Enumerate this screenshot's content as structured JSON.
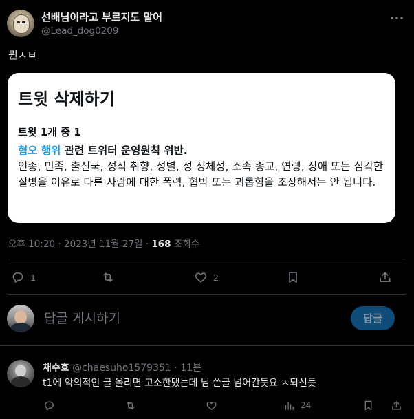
{
  "tweet": {
    "display_name": "선배님이라고 부르지도 말어",
    "handle": "@Lead_dog0209",
    "text": "뭔ㅅㅂ",
    "deleted_card": {
      "title": "트윗 삭제하기",
      "count": "트윗 1개 중 1",
      "reason_link": "혐오 행위",
      "reason_rest": " 관련 트위터 운영원칙 위반.",
      "description": "인종, 민족, 출신국, 성적 취향, 성별, 성 정체성, 소속 종교, 연령, 장애 또는 심각한 질병을 이유로 다른 사람에 대한 폭력, 협박 또는 괴롭힘을 조장해서는 안 됩니다."
    },
    "meta": {
      "timestamp": "오후 10:20 · 2023년 11월 27일 · ",
      "views_count": "168",
      "views_label": " 조회수"
    },
    "actions": {
      "replies": "1",
      "likes": "2"
    }
  },
  "composer": {
    "placeholder": "답글 게시하기",
    "button_label": "답글"
  },
  "reply": {
    "name": "채수호",
    "handle_time": " @chaesuho1579351 · 11분",
    "text": "t1에 악의적인 글 올리면 고소한댔는데 님 쓴글 넘어간듯요 ㅈ되신듯",
    "views": "24"
  },
  "colors": {
    "background": "#000000",
    "accent": "#1d9bf0",
    "muted": "#71767b",
    "text": "#e7e9ea"
  }
}
